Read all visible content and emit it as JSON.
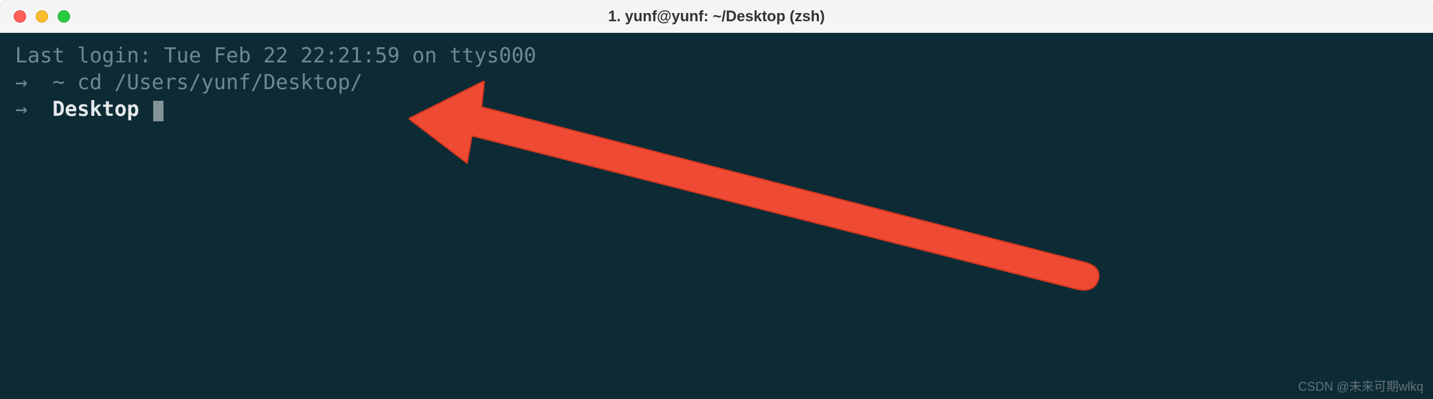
{
  "titlebar": {
    "title": "1. yunf@yunf: ~/Desktop (zsh)"
  },
  "terminal": {
    "last_login": "Last login: Tue Feb 22 22:21:59 on ttys000",
    "line1": {
      "arrow": "→",
      "path": "~",
      "command": "cd /Users/yunf/Desktop/"
    },
    "line2": {
      "arrow": "→",
      "cwd": "Desktop"
    }
  },
  "watermark": "CSDN @未来可期wlkq"
}
